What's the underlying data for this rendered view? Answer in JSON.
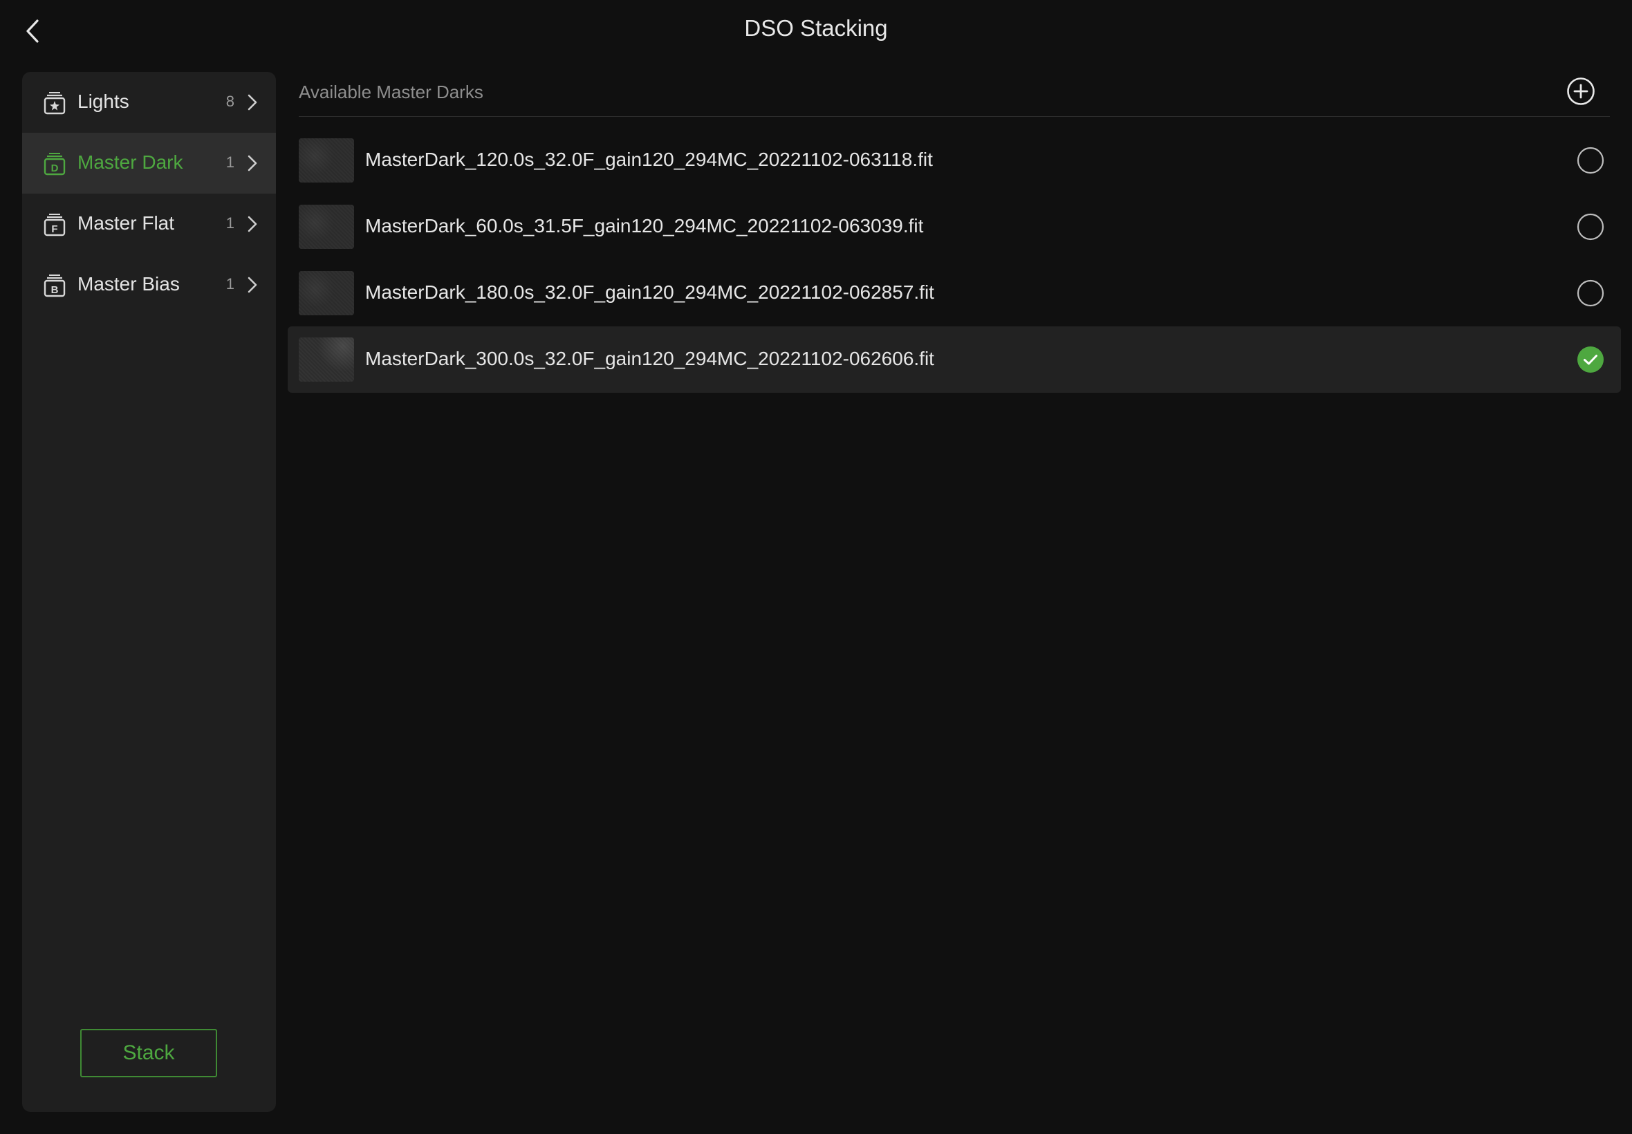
{
  "header": {
    "title": "DSO Stacking"
  },
  "sidebar": {
    "items": [
      {
        "label": "Lights",
        "count": "8",
        "icon": "lights-icon",
        "active": false
      },
      {
        "label": "Master Dark",
        "count": "1",
        "icon": "master-dark-icon",
        "active": true
      },
      {
        "label": "Master Flat",
        "count": "1",
        "icon": "master-flat-icon",
        "active": false
      },
      {
        "label": "Master Bias",
        "count": "1",
        "icon": "master-bias-icon",
        "active": false
      }
    ],
    "stack_label": "Stack"
  },
  "main": {
    "section_title": "Available Master Darks",
    "files": [
      {
        "name": "MasterDark_120.0s_32.0F_gain120_294MC_20221102-063118.fit",
        "selected": false
      },
      {
        "name": "MasterDark_60.0s_31.5F_gain120_294MC_20221102-063039.fit",
        "selected": false
      },
      {
        "name": "MasterDark_180.0s_32.0F_gain120_294MC_20221102-062857.fit",
        "selected": false
      },
      {
        "name": "MasterDark_300.0s_32.0F_gain120_294MC_20221102-062606.fit",
        "selected": true
      }
    ]
  },
  "colors": {
    "accent": "#4ea840",
    "background": "#101010",
    "panel": "#1f1f1f",
    "active_item": "#2e2e2e"
  }
}
